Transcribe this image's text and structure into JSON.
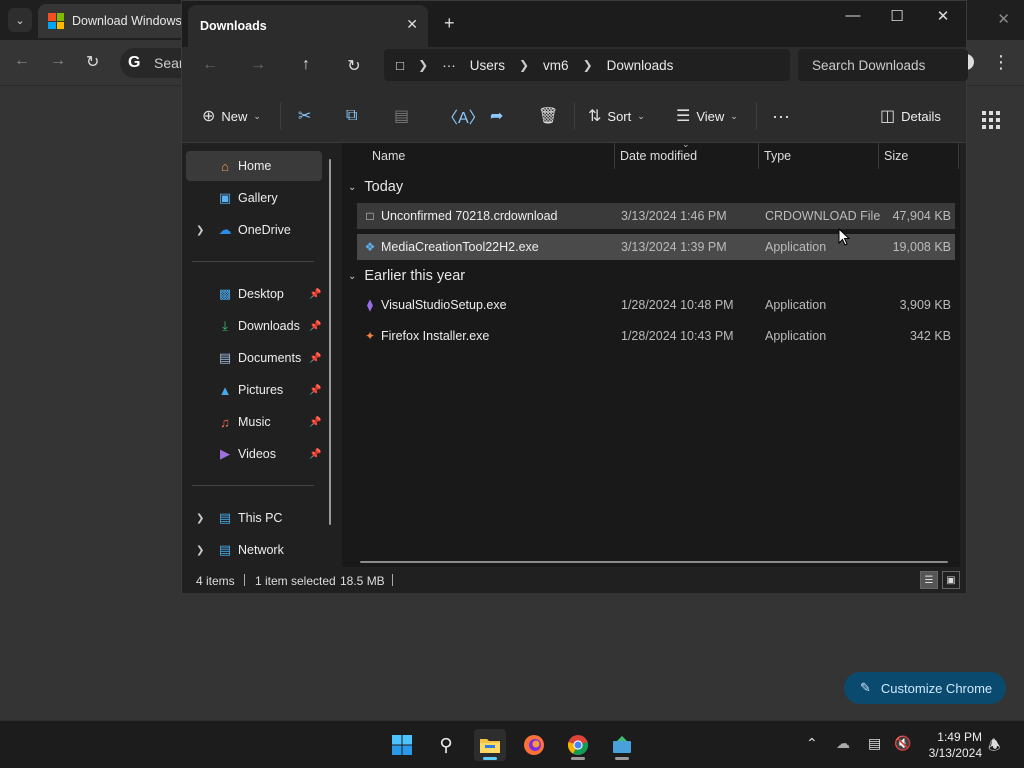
{
  "chrome": {
    "tab_title": "Download Windows",
    "omnibox_text": "Sear",
    "customize_label": "Customize Chrome"
  },
  "explorer": {
    "tab_title": "Downloads",
    "breadcrumb": [
      "Users",
      "vm6",
      "Downloads"
    ],
    "search_placeholder": "Search Downloads",
    "commands": {
      "new": "New",
      "sort": "Sort",
      "view": "View",
      "details": "Details"
    },
    "nav": {
      "home": "Home",
      "gallery": "Gallery",
      "onedrive": "OneDrive",
      "desktop": "Desktop",
      "downloads": "Downloads",
      "documents": "Documents",
      "pictures": "Pictures",
      "music": "Music",
      "videos": "Videos",
      "thispc": "This PC",
      "network": "Network"
    },
    "columns": {
      "name": "Name",
      "date": "Date modified",
      "type": "Type",
      "size": "Size"
    },
    "groups": [
      {
        "label": "Today",
        "files": [
          {
            "name": "Unconfirmed 70218.crdownload",
            "date": "3/13/2024 1:46 PM",
            "type": "CRDOWNLOAD File",
            "size": "47,904 KB",
            "icon": "blank-file-icon"
          },
          {
            "name": "MediaCreationTool22H2.exe",
            "date": "3/13/2024 1:39 PM",
            "type": "Application",
            "size": "19,008 KB",
            "icon": "media-creation-icon"
          }
        ]
      },
      {
        "label": "Earlier this year",
        "files": [
          {
            "name": "VisualStudioSetup.exe",
            "date": "1/28/2024 10:48 PM",
            "type": "Application",
            "size": "3,909 KB",
            "icon": "visual-studio-icon"
          },
          {
            "name": "Firefox Installer.exe",
            "date": "1/28/2024 10:43 PM",
            "type": "Application",
            "size": "342 KB",
            "icon": "firefox-installer-icon"
          }
        ]
      }
    ],
    "status": {
      "items": "4 items",
      "selected": "1 item selected",
      "size": "18.5 MB"
    }
  },
  "taskbar": {
    "time": "1:49 PM",
    "date": "3/13/2024"
  },
  "colors": {
    "accent": "#60cdff",
    "folder": "#f5c242",
    "onedrive": "#2b8ce6"
  }
}
